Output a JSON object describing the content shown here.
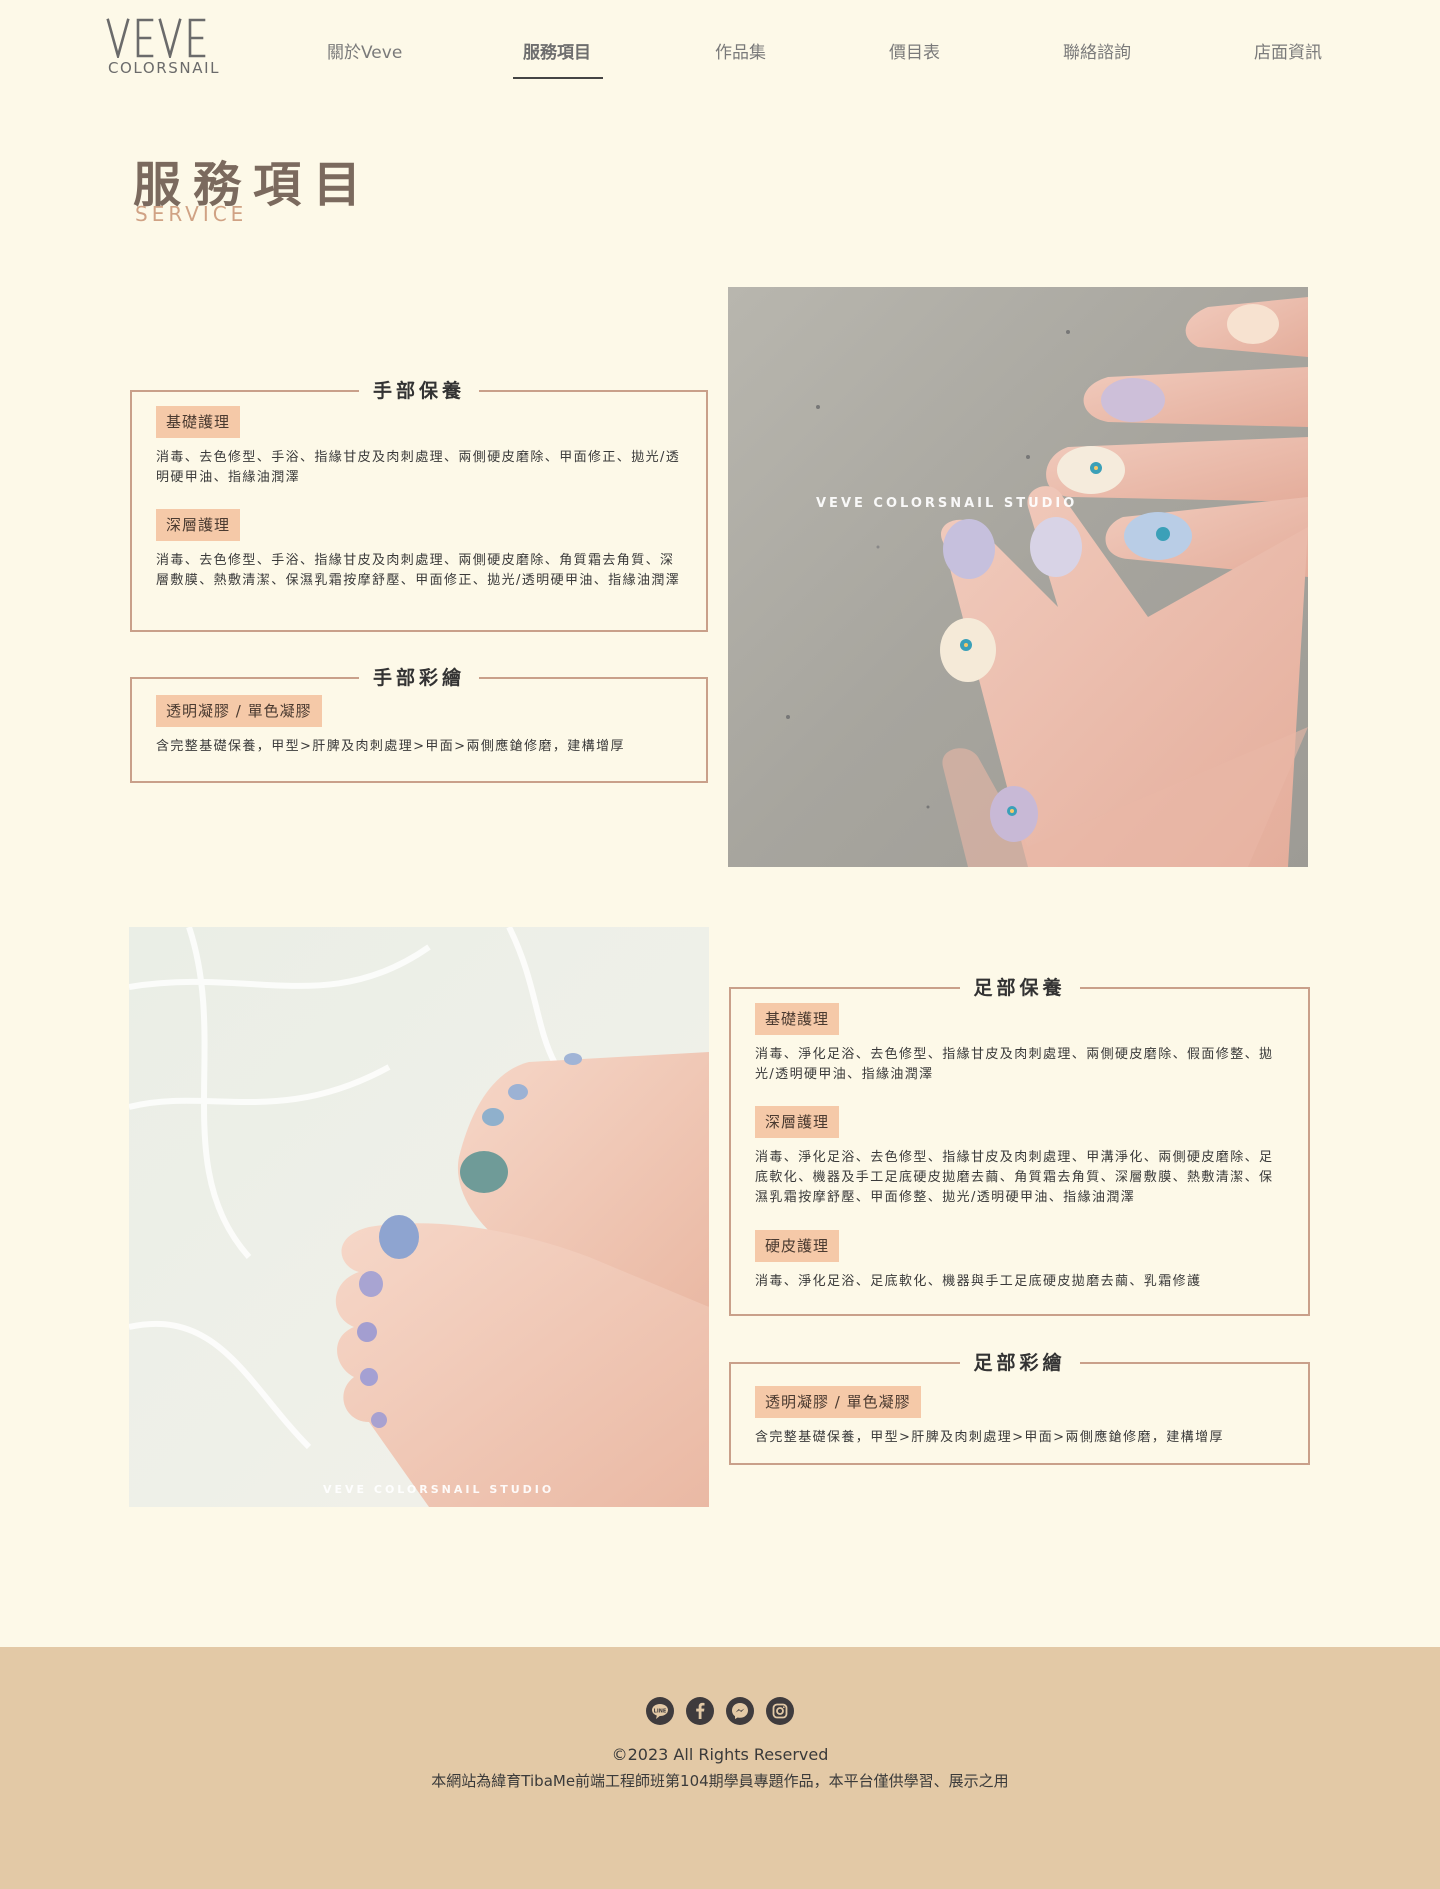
{
  "header": {
    "logo_mark": "VEVE",
    "logo_sub": "COLORSNAIL",
    "nav": [
      {
        "label": "關於Veve"
      },
      {
        "label": "服務項目"
      },
      {
        "label": "作品集"
      },
      {
        "label": "價目表"
      },
      {
        "label": "聯絡諮詢"
      },
      {
        "label": "店面資訊"
      }
    ]
  },
  "page": {
    "title": "服務項目",
    "subtitle": "SERVICE"
  },
  "hand_care": {
    "title": "手部保養",
    "items": [
      {
        "tag": "基礎護理",
        "desc": "消毒、去色修型、手浴、指緣甘皮及肉刺處理、兩側硬皮磨除、甲面修正、拋光/透明硬甲油、指緣油潤澤"
      },
      {
        "tag": "深層護理",
        "desc": "消毒、去色修型、手浴、指緣甘皮及肉刺處理、兩側硬皮磨除、角質霜去角質、深層敷膜、熱敷清潔、保濕乳霜按摩舒壓、甲面修正、拋光/透明硬甲油、指緣油潤澤"
      }
    ]
  },
  "hand_paint": {
    "title": "手部彩繪",
    "items": [
      {
        "tag": "透明凝膠 / 單色凝膠",
        "desc": "含完整基礎保養，甲型>肝脾及肉刺處理>甲面>兩側應鎗修磨，建構增厚"
      }
    ]
  },
  "foot_care": {
    "title": "足部保養",
    "items": [
      {
        "tag": "基礎護理",
        "desc": "消毒、淨化足浴、去色修型、指緣甘皮及肉刺處理、兩側硬皮磨除、假面修整、拋光/透明硬甲油、指緣油潤澤"
      },
      {
        "tag": "深層護理",
        "desc": "消毒、淨化足浴、去色修型、指緣甘皮及肉刺處理、甲溝淨化、兩側硬皮磨除、足底軟化、機器及手工足底硬皮拋磨去繭、角質霜去角質、深層敷膜、熱敷清潔、保濕乳霜按摩舒壓、甲面修整、拋光/透明硬甲油、指緣油潤澤"
      },
      {
        "tag": "硬皮護理",
        "desc": "消毒、淨化足浴、足底軟化、機器與手工足底硬皮拋磨去繭、乳霜修護"
      }
    ]
  },
  "foot_paint": {
    "title": "足部彩繪",
    "items": [
      {
        "tag": "透明凝膠 / 單色凝膠",
        "desc": "含完整基礎保養，甲型>肝脾及肉刺處理>甲面>兩側應鎗修磨，建構增厚"
      }
    ]
  },
  "photos": {
    "hand_watermark": "VEVE COLORSNAIL STUDIO",
    "foot_watermark": "VEVE COLORSNAIL STUDIO"
  },
  "footer": {
    "social_icons": [
      "line-icon",
      "facebook-icon",
      "messenger-icon",
      "instagram-icon"
    ],
    "copyright": "©2023 All Rights Reserved",
    "note": "本網站為緯育TibaMe前端工程師班第104期學員專題作品，本平台僅供學習、展示之用"
  },
  "colors": {
    "background": "#fdf9e8",
    "accent_border": "#c9a08a",
    "tag_bg": "#f5c9a8",
    "title_brown": "#7b6a5e",
    "subtitle_peach": "#d0a284",
    "footer_bg": "#e3c9a6"
  }
}
